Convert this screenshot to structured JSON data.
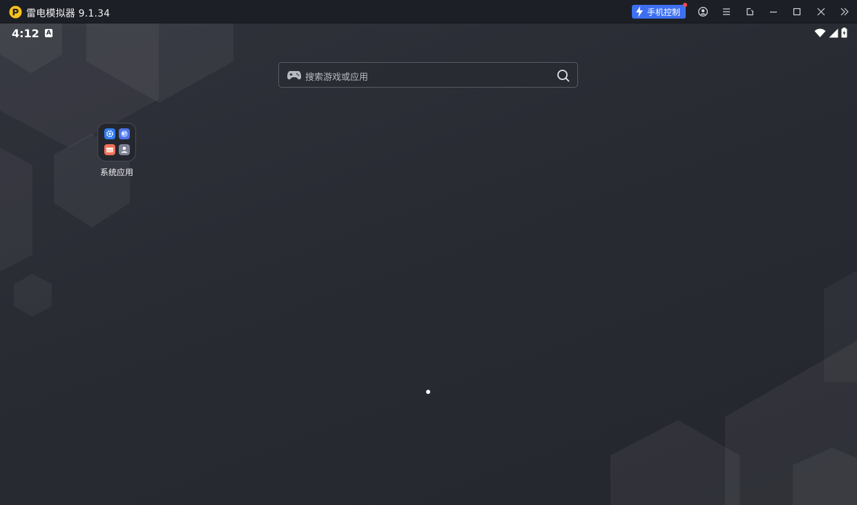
{
  "window": {
    "title": "雷电模拟器 9.1.34",
    "phone_control_label": "手机控制",
    "accent_color": "#3d6ff0",
    "toolbar_icons": [
      "account-icon",
      "menu-icon",
      "rotate-icon",
      "minimize-icon",
      "maximize-icon",
      "close-icon",
      "expand-sidebar-icon"
    ]
  },
  "status_bar": {
    "time": "4:12",
    "notification_glyph": "A"
  },
  "search": {
    "placeholder": "搜索游戏或应用"
  },
  "home": {
    "folder_label": "系统应用",
    "folder_apps": [
      "settings-icon",
      "browser-icon",
      "wallet-icon",
      "contacts-icon"
    ]
  }
}
